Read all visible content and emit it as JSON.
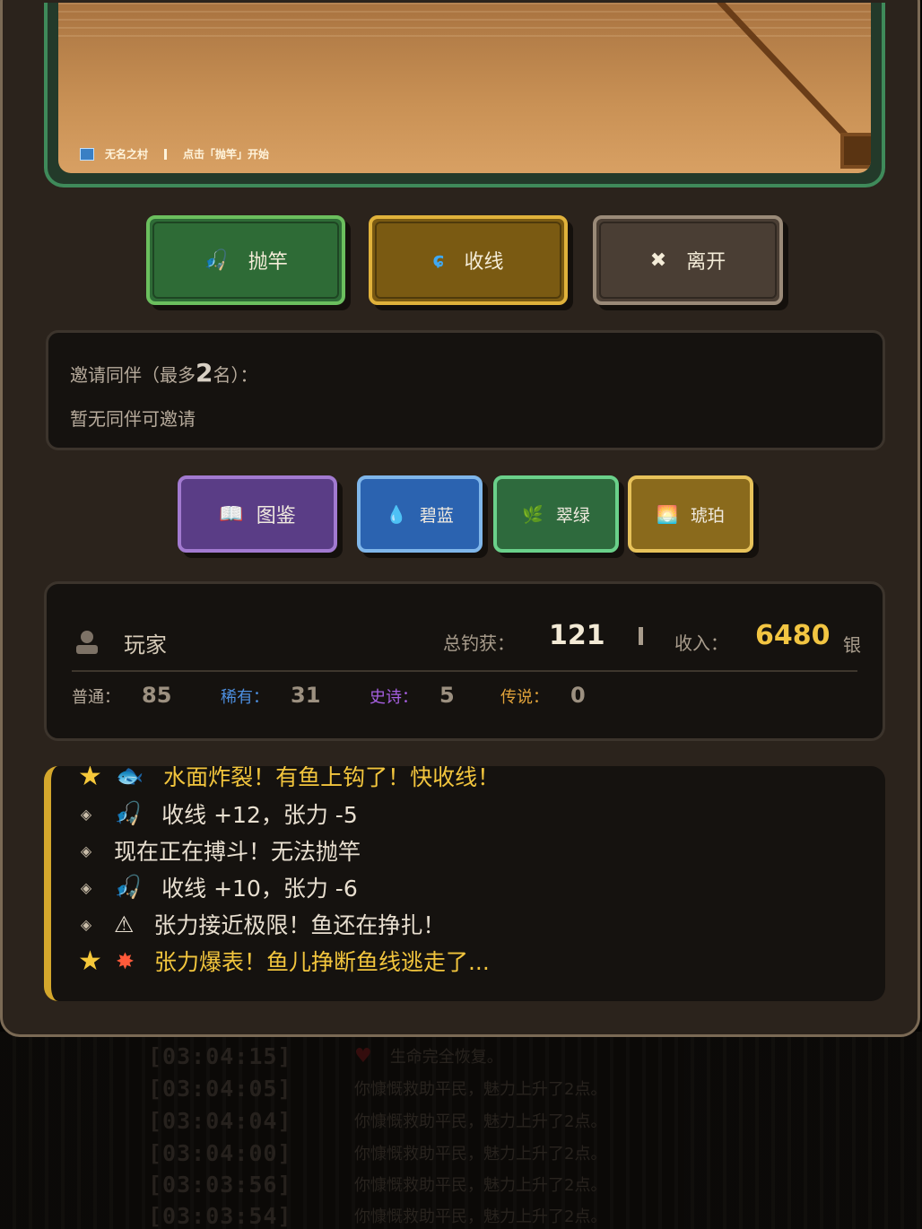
{
  "scene": {
    "location": "无名之村",
    "hint": "点击「抛竿」开始"
  },
  "actions": {
    "cast_label": "抛竿",
    "reel_label": "收线",
    "leave_label": "离开"
  },
  "invite": {
    "title_prefix": "邀请同伴（最多",
    "title_count": "2",
    "title_suffix": "名）：",
    "empty_text": "暂无同伴可邀请"
  },
  "tabs": {
    "book_label": "图鉴",
    "blue_label": "碧蓝",
    "green_label": "翠绿",
    "amber_label": "琥珀"
  },
  "stats": {
    "player_name": "玩家",
    "total_label": "总钓获：",
    "total_value": "121",
    "income_label": "收入：",
    "income_value": "6480",
    "income_unit": "银",
    "common_label": "普通：",
    "common_value": "85",
    "rare_label": "稀有：",
    "rare_value": "31",
    "epic_label": "史诗：",
    "epic_value": "5",
    "legend_label": "传说：",
    "legend_value": "0",
    "colors": {
      "rare": "#4d8fe0",
      "epic": "#a65fe0",
      "legend": "#e0a23a"
    }
  },
  "log": [
    {
      "text": "水面炸裂！有鱼上钩了！快收线！",
      "type": "highlight",
      "icon": "fish-icon"
    },
    {
      "text": "收线 +12，张力 -5",
      "type": "normal",
      "icon": "reel-icon"
    },
    {
      "text": "现在正在搏斗！无法抛竿",
      "type": "normal",
      "icon": ""
    },
    {
      "text": "收线 +10，张力 -6",
      "type": "normal",
      "icon": "reel-icon"
    },
    {
      "text": "张力接近极限！鱼还在挣扎！",
      "type": "normal",
      "icon": "warning-icon"
    },
    {
      "text": "张力爆表！鱼儿挣断鱼线逃走了...",
      "type": "highlight",
      "icon": "explosion-icon"
    }
  ],
  "background_log": [
    {
      "time": "[03:04:15]",
      "msg": "生命完全恢复。"
    },
    {
      "time": "[03:04:05]",
      "msg": "你慷慨救助平民，魅力上升了2点。"
    },
    {
      "time": "[03:04:04]",
      "msg": "你慷慨救助平民，魅力上升了2点。"
    },
    {
      "time": "[03:04:00]",
      "msg": "你慷慨救助平民，魅力上升了2点。"
    },
    {
      "time": "[03:03:56]",
      "msg": "你慷慨救助平民，魅力上升了2点。"
    },
    {
      "time": "[03:03:54]",
      "msg": "你慷慨救助平民，魅力上升了2点。"
    }
  ]
}
